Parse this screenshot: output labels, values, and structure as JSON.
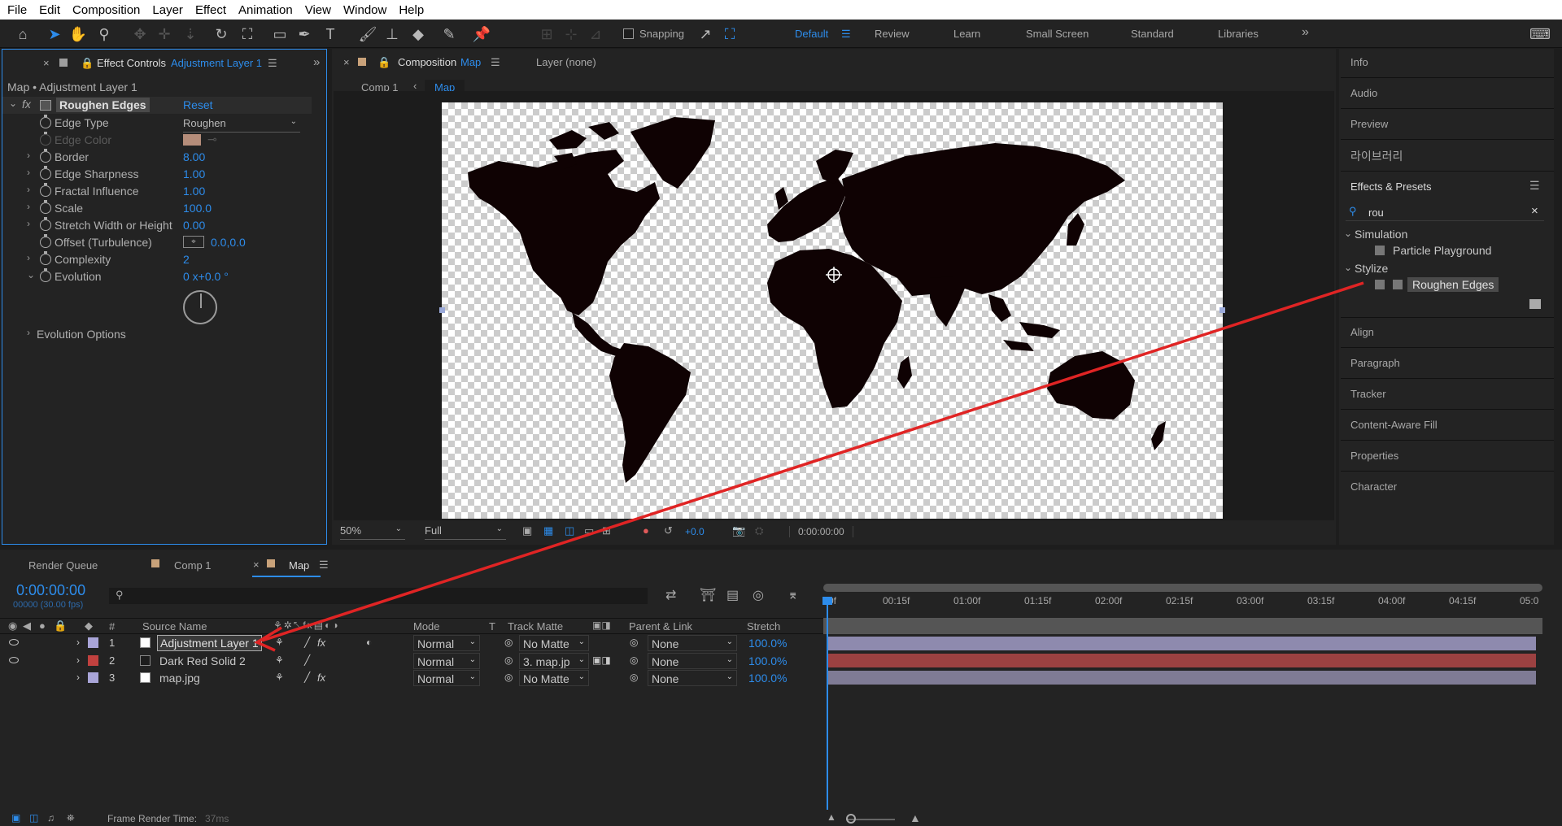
{
  "menu": [
    "File",
    "Edit",
    "Composition",
    "Layer",
    "Effect",
    "Animation",
    "View",
    "Window",
    "Help"
  ],
  "toolbar": {
    "snapping_label": "Snapping",
    "workspaces": [
      "Default",
      "Review",
      "Learn",
      "Small Screen",
      "Standard",
      "Libraries"
    ],
    "active_workspace": "Default"
  },
  "effect_controls": {
    "tab_label": "Effect Controls",
    "tab_layer": "Adjustment Layer 1",
    "header": "Map • Adjustment Layer 1",
    "effect_name": "Roughen Edges",
    "reset_label": "Reset",
    "properties": [
      {
        "label": "Edge Type",
        "value": "Roughen"
      },
      {
        "label": "Edge Color",
        "value": ""
      },
      {
        "label": "Border",
        "value": "8.00"
      },
      {
        "label": "Edge Sharpness",
        "value": "1.00"
      },
      {
        "label": "Fractal Influence",
        "value": "1.00"
      },
      {
        "label": "Scale",
        "value": "100.0"
      },
      {
        "label": "Stretch Width or Height",
        "value": "0.00"
      },
      {
        "label": "Offset (Turbulence)",
        "value": "0.0,0.0"
      },
      {
        "label": "Complexity",
        "value": "2"
      },
      {
        "label": "Evolution",
        "value": "0 x+0.0 °"
      }
    ],
    "evolution_options_label": "Evolution Options",
    "edge_color_hex": "#d9a890"
  },
  "composition": {
    "tab_label": "Composition",
    "tab_comp": "Map",
    "layer_tab": "Layer (none)",
    "breadcrumbs": [
      "Comp 1",
      "Map"
    ],
    "zoom": "50%",
    "resolution": "Full",
    "exposure": "+0.0",
    "timecode": "0:00:00:00"
  },
  "right_panel": {
    "items_top": [
      "Info",
      "Audio",
      "Preview",
      "라이브러리"
    ],
    "effects_presets_label": "Effects & Presets",
    "search_value": "rou",
    "tree": [
      {
        "group": "Simulation",
        "items": [
          "Particle Playground"
        ]
      },
      {
        "group": "Stylize",
        "items": [
          "Roughen Edges"
        ]
      }
    ],
    "items_bottom": [
      "Align",
      "Paragraph",
      "Tracker",
      "Content-Aware Fill",
      "Properties",
      "Character"
    ]
  },
  "timeline": {
    "tabs": [
      "Render Queue",
      "Comp 1",
      "Map"
    ],
    "active_tab": "Map",
    "current_time": "0:00:00:00",
    "frame_info": "00000 (30.00 fps)",
    "columns": {
      "hash": "#",
      "source_name": "Source Name",
      "mode": "Mode",
      "t": "T",
      "track_matte": "Track Matte",
      "parent_link": "Parent & Link",
      "stretch": "Stretch"
    },
    "layers": [
      {
        "num": "1",
        "name": "Adjustment Layer 1",
        "mode": "Normal",
        "matte": "No Matte",
        "parent": "None",
        "stretch": "100.0%",
        "label_color": "#a9a5d8",
        "bar_color": "#8e8aae"
      },
      {
        "num": "2",
        "name": "Dark Red Solid 2",
        "mode": "Normal",
        "matte": "3. map.jp",
        "parent": "None",
        "stretch": "100.0%",
        "label_color": "#c1413f",
        "bar_color": "#9c4141"
      },
      {
        "num": "3",
        "name": "map.jpg",
        "mode": "Normal",
        "matte": "No Matte",
        "parent": "None",
        "stretch": "100.0%",
        "label_color": "#a9a5d8",
        "bar_color": "#7f7b95"
      }
    ],
    "ruler": [
      "0f",
      "00:15f",
      "01:00f",
      "01:15f",
      "02:00f",
      "02:15f",
      "03:00f",
      "03:15f",
      "04:00f",
      "04:15f",
      "05:0"
    ],
    "footer": "Frame Render Time:",
    "footer_value": "37ms"
  }
}
